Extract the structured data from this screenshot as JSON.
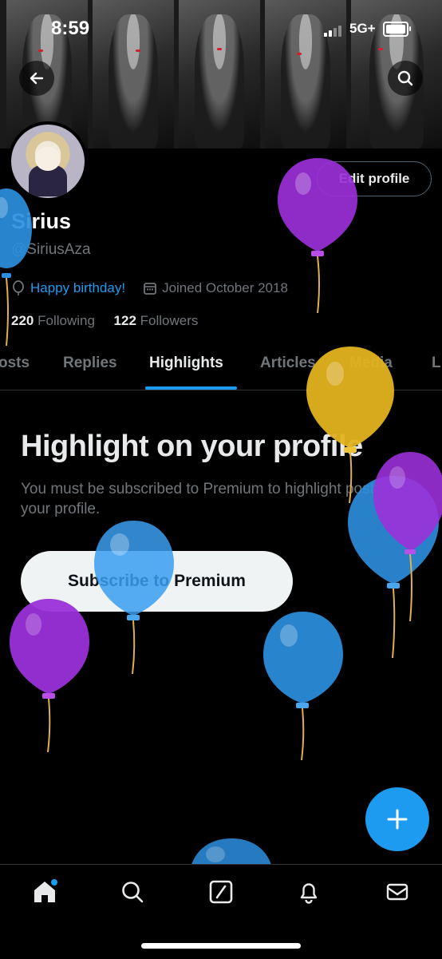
{
  "status_bar": {
    "time": "8:59",
    "network": "5G+"
  },
  "profile": {
    "name": "Sirius",
    "handle": "@SiriusAza",
    "birthday_text": "Happy birthday!",
    "joined_text": "Joined October 2018",
    "following_count": "220",
    "following_label": "Following",
    "followers_count": "122",
    "followers_label": "Followers",
    "edit_profile_label": "Edit profile"
  },
  "tabs": [
    {
      "label": "osts"
    },
    {
      "label": "Replies"
    },
    {
      "label": "Highlights",
      "active": true
    },
    {
      "label": "Articles"
    },
    {
      "label": "Media"
    },
    {
      "label": "L"
    }
  ],
  "highlights": {
    "title": "Highlight on your profile",
    "description": "You must be subscribed to Premium to highlight posts on your profile.",
    "subscribe_label": "Subscribe to Premium"
  },
  "icons": {
    "back": "back-arrow-icon",
    "search": "search-icon",
    "birthday": "balloon-icon",
    "calendar": "calendar-icon",
    "compose": "plus-icon",
    "nav": [
      "home-icon",
      "search-icon",
      "grok-icon",
      "bell-icon",
      "mail-icon"
    ]
  },
  "colors": {
    "accent": "#1d9bf0",
    "background": "#000000",
    "muted_text": "#71767b",
    "balloon_blue": "#2d8fe0",
    "balloon_purple": "#9b30d9",
    "balloon_yellow": "#e3b21e"
  }
}
